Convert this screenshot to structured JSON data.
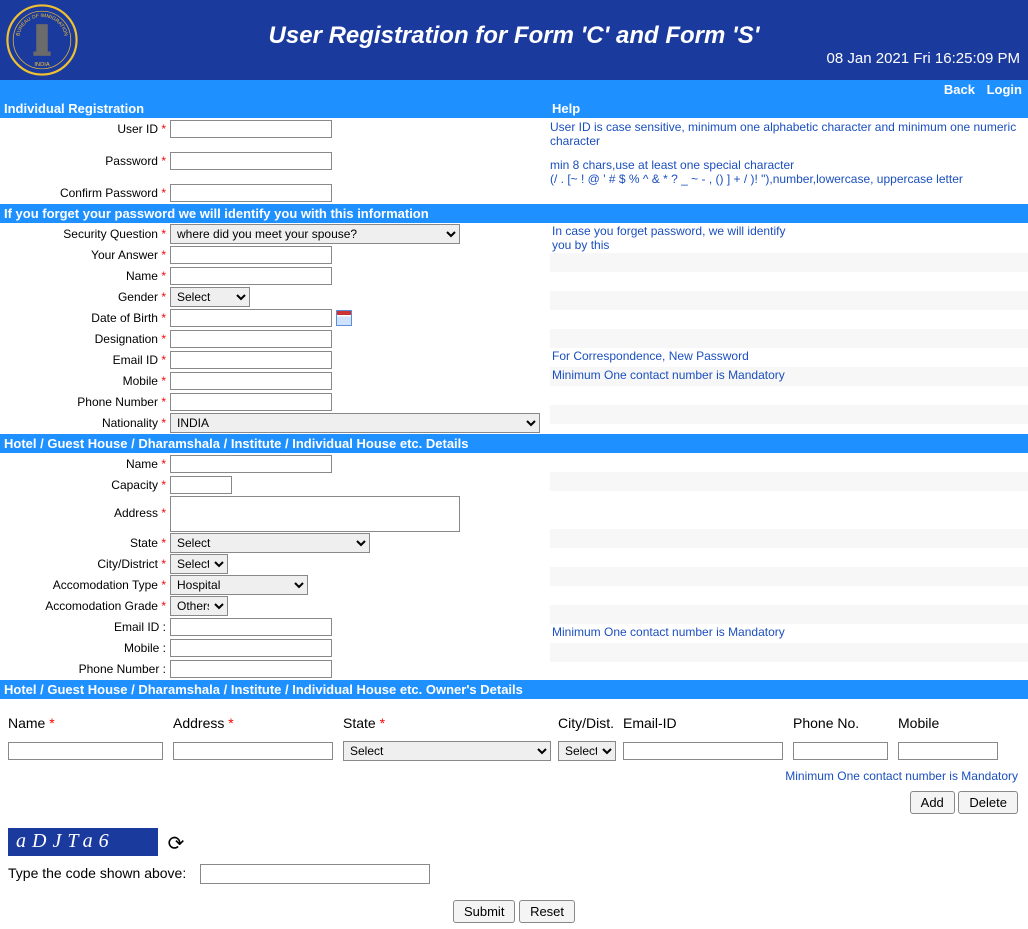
{
  "banner": {
    "title": "User Registration for Form 'C' and Form 'S'",
    "timestamp": "08 Jan 2021 Fri 16:25:09 PM",
    "logo_top": "BUREAU OF IMMIGRATION",
    "logo_bottom": "INDIA"
  },
  "topbar": {
    "back": "Back",
    "login": "Login"
  },
  "sections": {
    "reg": "Individual Registration",
    "help": "Help",
    "security": "If you forget your password we will identify you with this information",
    "hotel": "Hotel / Guest House / Dharamshala / Institute / Individual House etc. Details",
    "owner": "Hotel / Guest House / Dharamshala / Institute / Individual House etc.  Owner's Details"
  },
  "labels": {
    "userid": "User ID",
    "password": "Password",
    "confirm": "Confirm Password",
    "secq": "Security Question",
    "answer": "Your Answer",
    "name": "Name",
    "gender": "Gender",
    "dob": "Date of Birth",
    "designation": "Designation",
    "email": "Email ID",
    "mobile": "Mobile",
    "phone": "Phone Number",
    "nationality": "Nationality",
    "capacity": "Capacity",
    "address": "Address",
    "state": "State",
    "city": "City/District",
    "acctype": "Accomodation Type",
    "accgrade": "Accomodation Grade",
    "emailid_c": "Email ID :",
    "mobile_c": "Mobile :",
    "phone_c": "Phone Number :"
  },
  "help": {
    "userid": "User ID is case sensitive, minimum one alphabetic character and minimum one numeric character",
    "pwd1": "min 8 chars,use at least one special character",
    "pwd2": "(/ . [~ ! @ ' # $ % ^ & * ? _ ~ - , () ] + / )! \"),number,lowercase, uppercase letter",
    "sec1": " In case you forget password, we will identify",
    "sec2": "you by this",
    "email": "For Correspondence, New Password",
    "mobile": "Minimum One contact number is Mandatory"
  },
  "selects": {
    "secq": "where did you meet your spouse?",
    "gender": "Select",
    "nationality": "INDIA",
    "state": "Select",
    "city": "Select",
    "acctype": "Hospital",
    "accgrade": "Others",
    "owner_state": "Select",
    "owner_city": "Select"
  },
  "owner": {
    "name": "Name",
    "address": "Address",
    "state": "State",
    "city": "City/Dist.",
    "email": "Email-ID",
    "phone": "Phone No.",
    "mobile": "Mobile",
    "note": "Minimum One contact number is Mandatory",
    "add": "Add",
    "delete": "Delete"
  },
  "captcha": {
    "text": "aDJTa6",
    "label": "Type the code shown above:",
    "submit": "Submit",
    "reset": "Reset"
  }
}
